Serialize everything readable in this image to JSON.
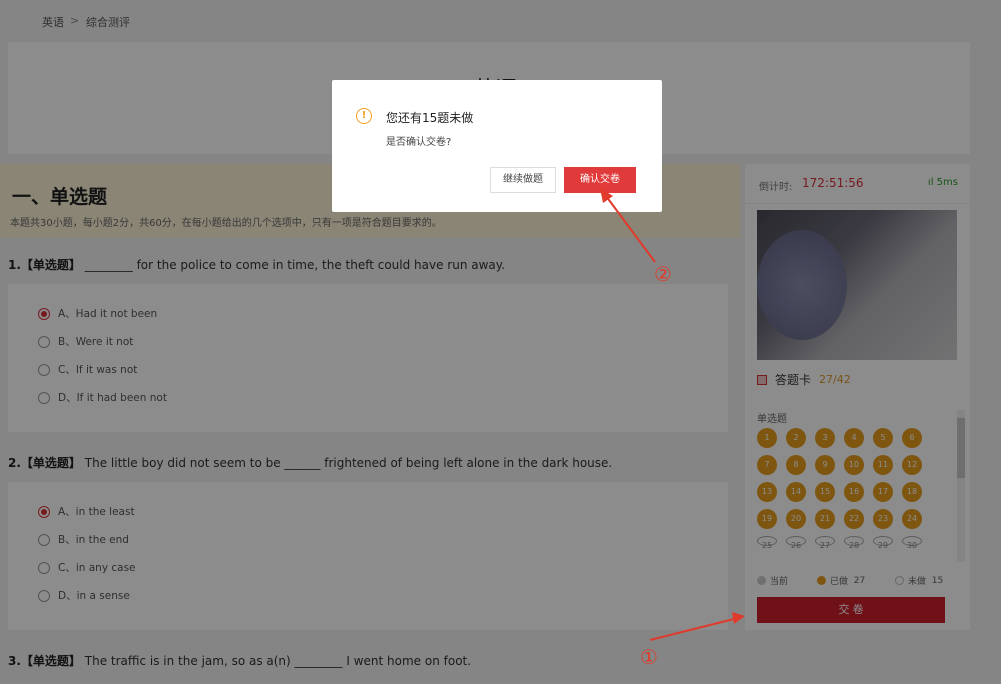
{
  "breadcrumb": {
    "first": "英语",
    "sep": ">",
    "second": "综合测评"
  },
  "page_title": "英语",
  "section": {
    "heading": "一、单选题",
    "description": "本题共30小题，每小题2分，共60分，在每小题给出的几个选项中，只有一项是符合题目要求的。"
  },
  "questions": [
    {
      "num": "1.",
      "tag": "【单选题】",
      "text": "________ for the police to come in time, the theft could have run away.",
      "options": [
        "A、Had it not been",
        "B、Were it not",
        "C、If it was not",
        "D、If it had been not"
      ],
      "selected": 0
    },
    {
      "num": "2.",
      "tag": "【单选题】",
      "text": "The little boy did not seem to be ______ frightened of being left alone in the dark house.",
      "options": [
        "A、in the least",
        "B、in the end",
        "C、in any case",
        "D、in a sense"
      ],
      "selected": 0
    },
    {
      "num": "3.",
      "tag": "【单选题】",
      "text": "The traffic is in the jam, so as a(n) ________ I went home on foot."
    }
  ],
  "sidebar": {
    "timer_label": "倒计时:",
    "timer_value": "172:51:56",
    "signal": "5ms",
    "answer_card_label": "答题卡",
    "answer_card_count": "27/42",
    "category": "单选题",
    "answered": [
      "1",
      "2",
      "3",
      "4",
      "5",
      "6",
      "7",
      "8",
      "9",
      "10",
      "11",
      "12",
      "13",
      "14",
      "15",
      "16",
      "17",
      "18",
      "19",
      "20",
      "21",
      "22",
      "23",
      "24"
    ],
    "unanswered_partial": [
      "25",
      "26",
      "27",
      "28",
      "29",
      "30"
    ],
    "legend_current": "当前",
    "legend_done": "已做",
    "legend_done_count": "27",
    "legend_undone": "未做",
    "legend_undone_count": "15",
    "submit_label": "交 卷",
    "colors": {
      "answered": "#e59d1c",
      "accent": "#cc1f2c"
    }
  },
  "modal": {
    "message": "您还有15题未做",
    "question": "是否确认交卷?",
    "continue_label": "继续做题",
    "confirm_label": "确认交卷"
  },
  "annotations": {
    "marker_1": "①",
    "marker_2": "②"
  }
}
